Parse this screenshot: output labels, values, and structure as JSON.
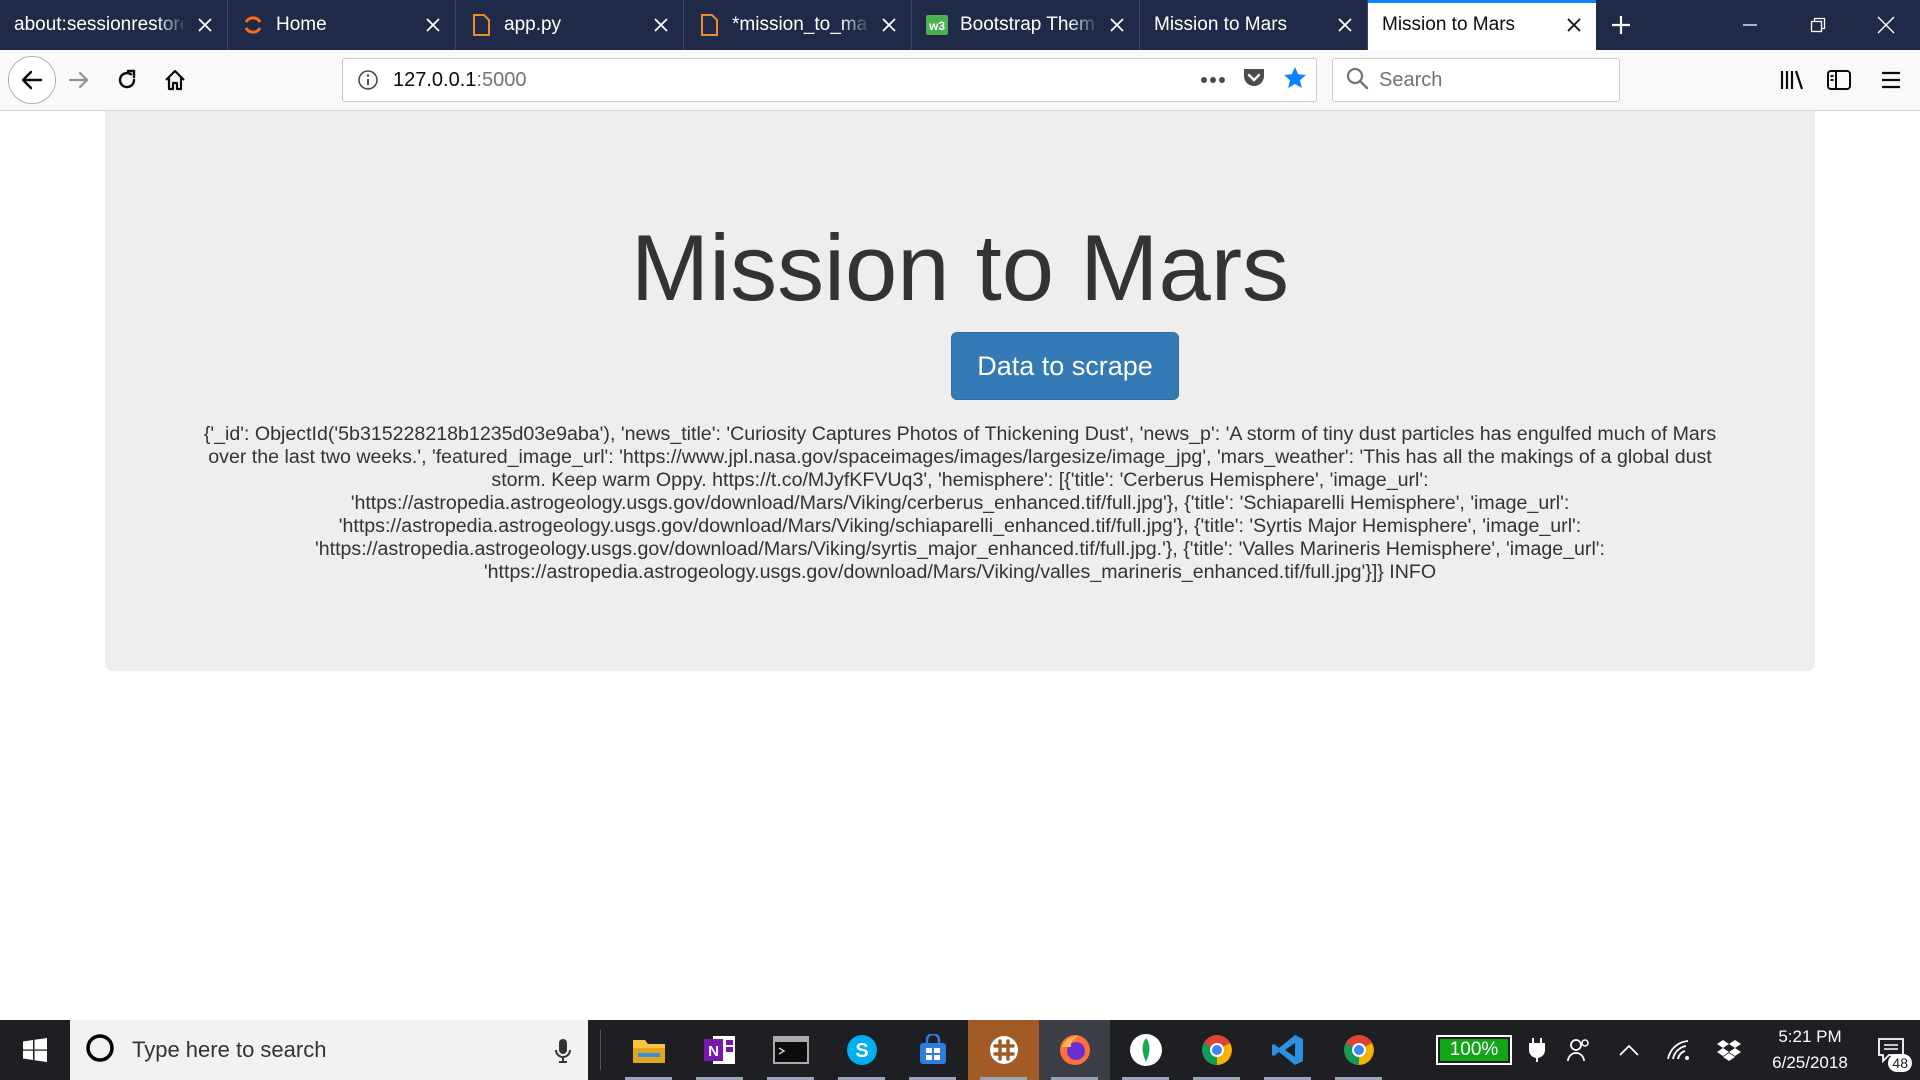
{
  "browser": {
    "tabs": [
      {
        "label": "about:sessionrestore",
        "favicon": "none",
        "active": false
      },
      {
        "label": "Home",
        "favicon": "orange-circle-icon",
        "active": false
      },
      {
        "label": "app.py",
        "favicon": "file-icon",
        "active": false
      },
      {
        "label": "*mission_to_mars",
        "favicon": "file-icon",
        "active": false
      },
      {
        "label": "Bootstrap Theme",
        "favicon": "bootstrap-w3-icon",
        "active": false
      },
      {
        "label": "Mission to Mars",
        "favicon": "none",
        "active": false
      },
      {
        "label": "Mission to Mars",
        "favicon": "none",
        "active": true
      }
    ],
    "url_host": "127.0.0.1",
    "url_port": ":5000",
    "search_placeholder": "Search",
    "accent_color": "#0a84ff"
  },
  "page": {
    "title": "Mission to Mars",
    "scrape_button_label": "Data to scrape",
    "mars_data_text": "{'_id': ObjectId('5b315228218b1235d03e9aba'), 'news_title': 'Curiosity Captures Photos of Thickening Dust', 'news_p': 'A storm of tiny dust particles has engulfed much of Mars over the last two weeks.', 'featured_image_url': 'https://www.jpl.nasa.gov/spaceimages/images/largesize/image_jpg', 'mars_weather': 'This has all the makings of a global dust storm. Keep warm Oppy. https://t.co/MJyfKFVUq3', 'hemisphere': [{'title': 'Cerberus Hemisphere', 'image_url': 'https://astropedia.astrogeology.usgs.gov/download/Mars/Viking/cerberus_enhanced.tif/full.jpg'}, {'title': 'Schiaparelli Hemisphere', 'image_url': 'https://astropedia.astrogeology.usgs.gov/download/Mars/Viking/schiaparelli_enhanced.tif/full.jpg'}, {'title': 'Syrtis Major Hemisphere', 'image_url': 'https://astropedia.astrogeology.usgs.gov/download/Mars/Viking/syrtis_major_enhanced.tif/full.jpg.'}, {'title': 'Valles Marineris Hemisphere', 'image_url': 'https://astropedia.astrogeology.usgs.gov/download/Mars/Viking/valles_marineris_enhanced.tif/full.jpg'}]} INFO",
    "button_color": "#337ab7",
    "jumbotron_color": "#eeeeee"
  },
  "taskbar": {
    "search_placeholder": "Type here to search",
    "apps": [
      "file-explorer-icon",
      "onenote-icon",
      "terminal-icon",
      "skype-icon",
      "store-icon",
      "slack-icon",
      "firefox-icon",
      "mongodb-icon",
      "chrome-icon",
      "vscode-icon",
      "chrome-icon"
    ],
    "battery_label": "100%",
    "time": "5:21 PM",
    "date": "6/25/2018",
    "notification_count": "48"
  }
}
